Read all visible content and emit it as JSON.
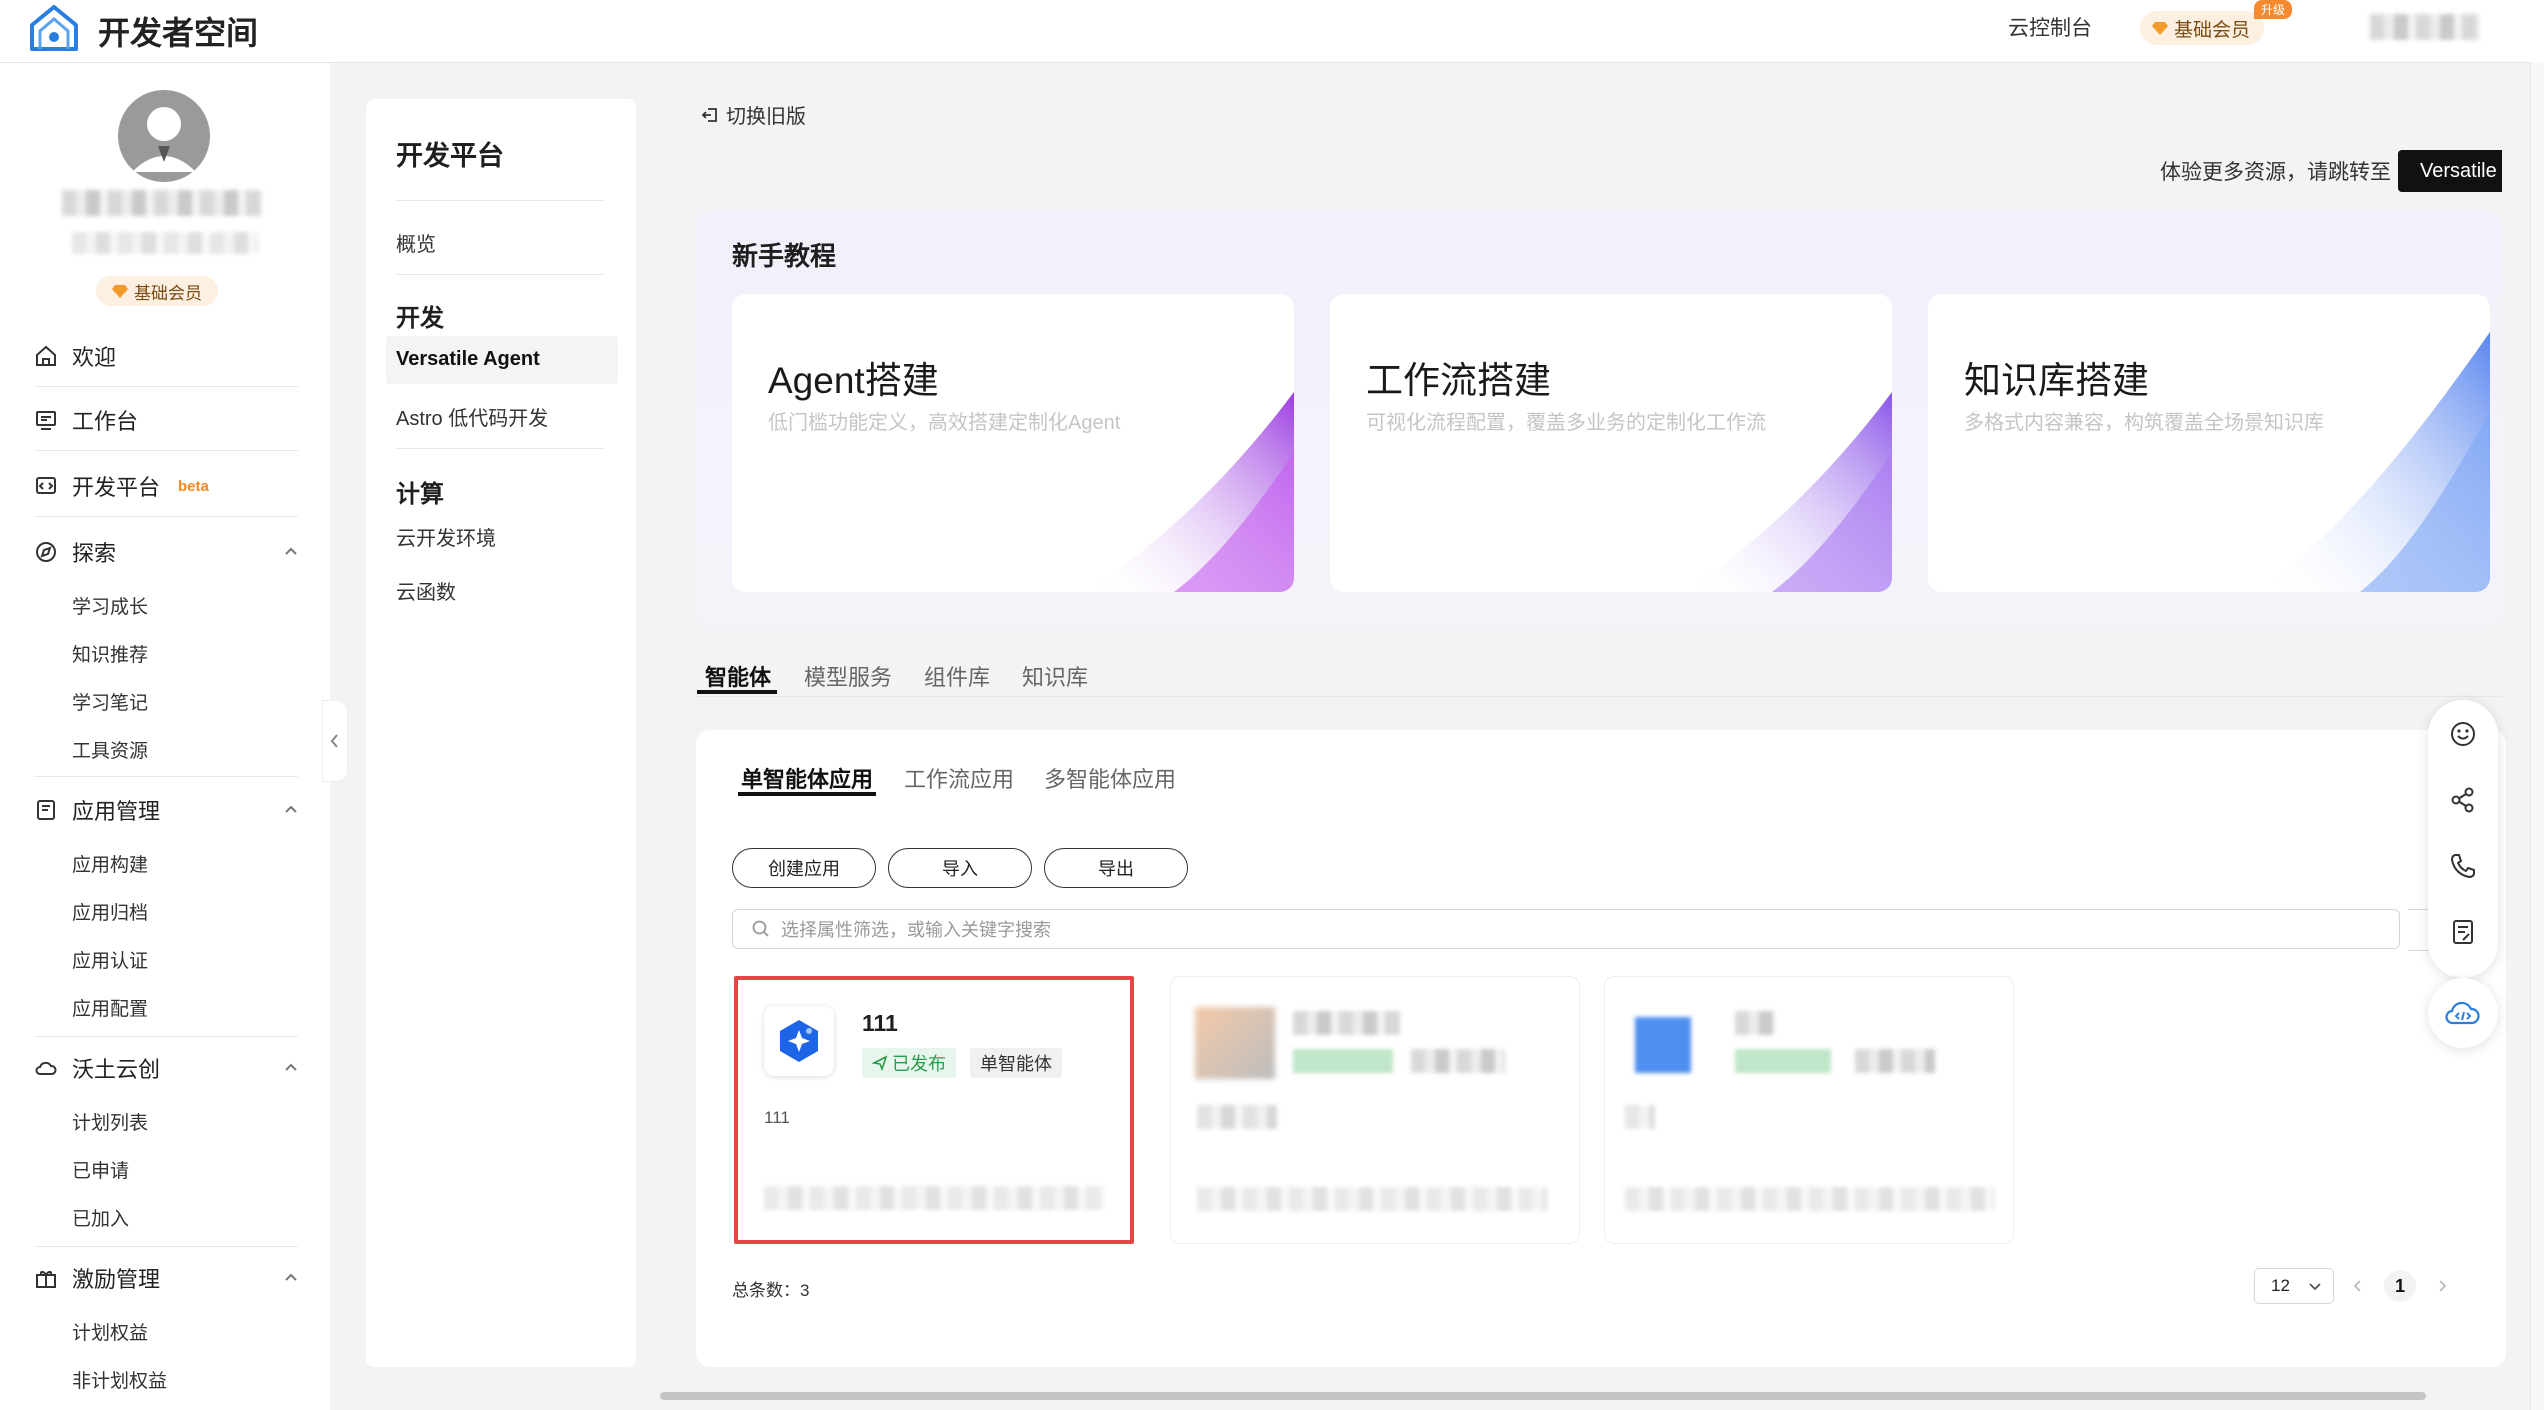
{
  "header": {
    "app_title": "开发者空间",
    "console_label": "云控制台",
    "member_label": "基础会员",
    "upgrade_tag": "升级"
  },
  "profile": {
    "member_label": "基础会员"
  },
  "sidebar": {
    "welcome": "欢迎",
    "workbench": "工作台",
    "dev_platform": "开发平台",
    "beta": "beta",
    "explore": {
      "label": "探索",
      "items": [
        "学习成长",
        "知识推荐",
        "学习笔记",
        "工具资源"
      ]
    },
    "app_mgmt": {
      "label": "应用管理",
      "items": [
        "应用构建",
        "应用归档",
        "应用认证",
        "应用配置"
      ]
    },
    "wotu": {
      "label": "沃土云创",
      "items": [
        "计划列表",
        "已申请",
        "已加入"
      ]
    },
    "incentive": {
      "label": "激励管理",
      "items": [
        "计划权益",
        "非计划权益"
      ]
    }
  },
  "panel2": {
    "title": "开发平台",
    "overview": "概览",
    "dev_head": "开发",
    "versatile": "Versatile Agent",
    "astro": "Astro 低代码开发",
    "compute_head": "计算",
    "cloud_env": "云开发环境",
    "cloud_func": "云函数"
  },
  "main": {
    "switch_old": "切换旧版",
    "tip": "体验更多资源，请跳转至",
    "versatile_btn": "Versatile",
    "tutorial_title": "新手教程",
    "cards": [
      {
        "title": "Agent搭建",
        "sub": "低门槛功能定义，高效搭建定制化Agent"
      },
      {
        "title": "工作流搭建",
        "sub": "可视化流程配置，覆盖多业务的定制化工作流"
      },
      {
        "title": "知识库搭建",
        "sub": "多格式内容兼容，构筑覆盖全场景知识库"
      }
    ],
    "tabs": [
      "智能体",
      "模型服务",
      "组件库",
      "知识库"
    ],
    "sub_tabs": [
      "单智能体应用",
      "工作流应用",
      "多智能体应用"
    ],
    "buttons": {
      "create": "创建应用",
      "import": "导入",
      "export": "导出"
    },
    "search_placeholder": "选择属性筛选，或输入关键字搜索",
    "app": {
      "name": "111",
      "status": "已发布",
      "type": "单智能体",
      "desc": "111"
    },
    "total": "总条数：3",
    "page_size": "12",
    "page": "1"
  },
  "colors": {
    "accent": "#111111",
    "member_bg": "#fdf0e0",
    "published_green": "#2c9b4e",
    "highlight_red": "#e84545"
  },
  "icons": [
    "logo-icon",
    "home-icon",
    "workbench-icon",
    "dev-icon",
    "explore-icon",
    "app-icon",
    "cloud-icon",
    "gift-icon",
    "chevron-up-icon",
    "switch-icon",
    "search-icon",
    "smile-icon",
    "share-icon",
    "phone-icon",
    "note-icon",
    "cloud-code-icon"
  ]
}
